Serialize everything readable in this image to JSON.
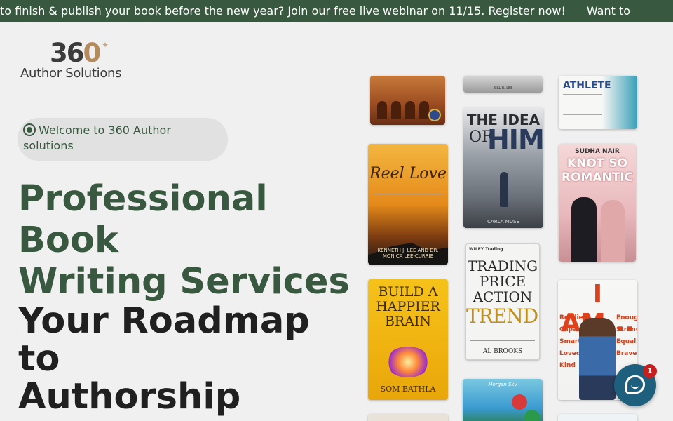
{
  "announcement_bar": {
    "text": "to finish & publish your book before the new year? Join our free live webinar on 11/15. Register now!",
    "text_repeat": "Want to",
    "bg_color": "#38583f"
  },
  "logo": {
    "number_a": "3",
    "number_b": "6",
    "number_c": "0",
    "name": "Author Solutions"
  },
  "hero": {
    "welcome_text": "Welcome to 360 Author solutions",
    "headline_line1": "Professional",
    "headline_line2": "Book",
    "headline_line3": "Writing Services",
    "subhead_line1": "Your Roadmap",
    "subhead_line2": "to",
    "subhead_line3": "Authorship",
    "accent_color": "#38583f"
  },
  "books": {
    "reel_love": {
      "title": "Reel Love",
      "authors": "KENNETH J. LEE AND DR. MONICA LEE-CURRIE"
    },
    "build_happier_brain": {
      "title": "BUILD A HAPPIER BRAIN",
      "author": "SOM BATHLA"
    },
    "top_middle": {
      "author": "BILL R. LEE"
    },
    "idea_of_him": {
      "title_top": "THE IDEA",
      "title_of": "OF",
      "title_him": "HIM",
      "author": "CARLA MUSE"
    },
    "trading": {
      "publisher": "WILEY Trading",
      "title": "TRADING PRICE ACTION",
      "title_accent": "TRENDS",
      "author": "AL BROOKS"
    },
    "young_athlete": {
      "title": "ATHLETE"
    },
    "knot_so_romantic": {
      "author": "SUDHA NAIR",
      "title": "KNOT SO ROMANTIC"
    },
    "i_am": {
      "title": "I AM...",
      "words_left": "Resilient Capable Smart Loved Kind",
      "words_right": "Enough Strong Equal Brave"
    },
    "bunny": {
      "author": "Morgan Sky"
    }
  },
  "chat_widget": {
    "badge_count": "1",
    "color": "#1f5f7e"
  }
}
